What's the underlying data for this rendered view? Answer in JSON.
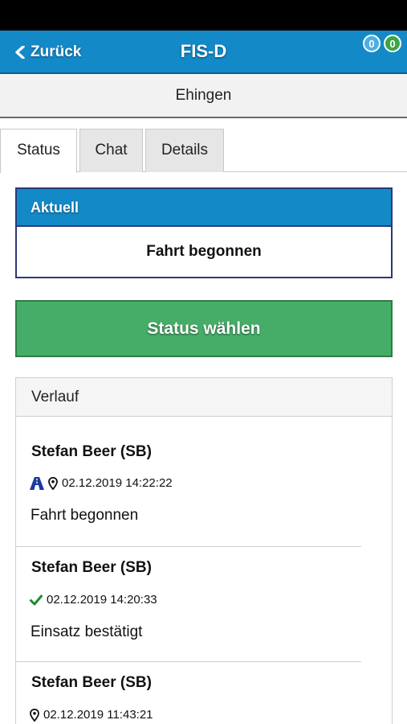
{
  "navbar": {
    "back_label": "Zurück",
    "title": "FIS-D",
    "badges": [
      {
        "value": "0",
        "color": "#4ab0e6"
      },
      {
        "value": "0",
        "color": "#3aa645"
      }
    ]
  },
  "subheader": {
    "title": "Ehingen"
  },
  "tabs": [
    {
      "label": "Status",
      "active": true
    },
    {
      "label": "Chat",
      "active": false
    },
    {
      "label": "Details",
      "active": false
    }
  ],
  "current": {
    "header": "Aktuell",
    "value": "Fahrt begonnen"
  },
  "status_button": {
    "label": "Status wählen",
    "color": "#46ad68"
  },
  "history": {
    "header": "Verlauf",
    "entries": [
      {
        "name": "Stefan Beer (SB)",
        "icons": [
          "highway-icon",
          "location-pin-icon"
        ],
        "timestamp": "02.12.2019 14:22:22",
        "text": "Fahrt begonnen"
      },
      {
        "name": "Stefan Beer (SB)",
        "icons": [
          "checkmark-icon"
        ],
        "timestamp": "02.12.2019 14:20:33",
        "text": "Einsatz bestätigt"
      },
      {
        "name": "Stefan Beer (SB)",
        "icons": [
          "location-pin-icon"
        ],
        "timestamp": "02.12.2019 11:43:21",
        "text": ""
      }
    ]
  },
  "colors": {
    "primary": "#1389c8",
    "success": "#46ad68",
    "border_dark": "#2b3a78"
  }
}
